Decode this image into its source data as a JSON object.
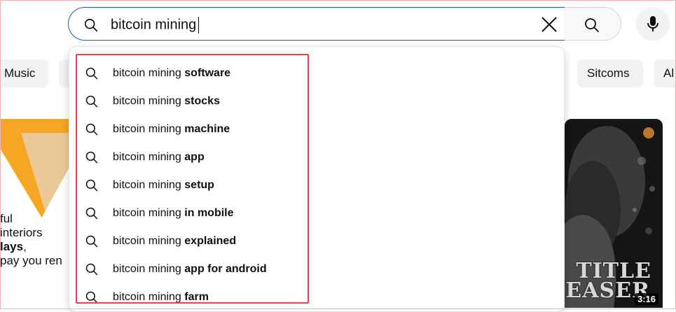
{
  "search": {
    "query": "bitcoin mining",
    "clear_icon": "close-icon",
    "search_icon": "search-icon",
    "mic_icon": "microphone-icon"
  },
  "chips": {
    "music": "Music",
    "sitcoms": "Sitcoms",
    "all": "Al"
  },
  "suggestions": [
    {
      "prefix": "bitcoin mining ",
      "completion": "software"
    },
    {
      "prefix": "bitcoin mining ",
      "completion": "stocks"
    },
    {
      "prefix": "bitcoin mining ",
      "completion": "machine"
    },
    {
      "prefix": "bitcoin mining ",
      "completion": "app"
    },
    {
      "prefix": "bitcoin mining ",
      "completion": "setup"
    },
    {
      "prefix": "bitcoin mining ",
      "completion": "in mobile"
    },
    {
      "prefix": "bitcoin mining ",
      "completion": "explained"
    },
    {
      "prefix": "bitcoin mining ",
      "completion": "app for android"
    },
    {
      "prefix": "bitcoin mining ",
      "completion": "farm"
    }
  ],
  "left_thumbnail": {
    "line1": "ful",
    "line2": "interiors",
    "line3_bold": "lays",
    "line3_rest": ",",
    "line4": "pay you ren"
  },
  "right_thumbnail": {
    "title_line1": "TITLE",
    "title_line2": "EASER",
    "duration": "3:16"
  },
  "colors": {
    "focus_border": "#1c62b9",
    "highlight_box": "#e0474c",
    "chip_bg": "#f2f2f2"
  }
}
